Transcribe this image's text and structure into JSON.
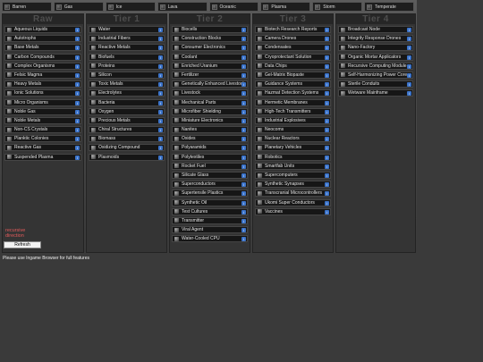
{
  "planets": [
    {
      "label": "Barren",
      "icon": "barren-planet-icon"
    },
    {
      "label": "Gas",
      "icon": "gas-planet-icon"
    },
    {
      "label": "Ice",
      "icon": "ice-planet-icon"
    },
    {
      "label": "Lava",
      "icon": "lava-planet-icon"
    },
    {
      "label": "Oceanic",
      "icon": "oceanic-planet-icon"
    },
    {
      "label": "Plasma",
      "icon": "plasma-planet-icon"
    },
    {
      "label": "Storm",
      "icon": "storm-planet-icon"
    },
    {
      "label": "Temperate",
      "icon": "temperate-planet-icon"
    }
  ],
  "info_glyph": "i",
  "tiers": [
    {
      "title": "Raw",
      "items": [
        "Aqueous Liquids",
        "Autotrophs",
        "Base Metals",
        "Carbon Compounds",
        "Complex Organisms",
        "Felsic Magma",
        "Heavy Metals",
        "Ionic Solutions",
        "Micro Organisms",
        "Noble Gas",
        "Noble Metals",
        "Non-CS Crystals",
        "Planktic Colonies",
        "Reactive Gas",
        "Suspended Plasma"
      ]
    },
    {
      "title": "Tier 1",
      "items": [
        "Water",
        "Industrial Fibers",
        "Reactive Metals",
        "Biofuels",
        "Proteins",
        "Silicon",
        "Toxic Metals",
        "Electrolytes",
        "Bacteria",
        "Oxygen",
        "Precious Metals",
        "Chiral Structures",
        "Biomass",
        "Oxidizing Compound",
        "Plasmoids"
      ]
    },
    {
      "title": "Tier 2",
      "items": [
        "Biocells",
        "Construction Blocks",
        "Consumer Electronics",
        "Coolant",
        "Enriched Uranium",
        "Fertilizer",
        "Genetically Enhanced Livestock",
        "Livestock",
        "Mechanical Parts",
        "Microfiber Shielding",
        "Miniature Electronics",
        "Nanites",
        "Oxides",
        "Polyaramids",
        "Polytextiles",
        "Rocket Fuel",
        "Silicate Glass",
        "Superconductors",
        "Supertensile Plastics",
        "Synthetic Oil",
        "Test Cultures",
        "Transmitter",
        "Viral Agent",
        "Water-Cooled CPU"
      ]
    },
    {
      "title": "Tier 3",
      "items": [
        "Biotech Research Reports",
        "Camera Drones",
        "Condensates",
        "Cryoprotectant Solution",
        "Data Chips",
        "Gel-Matrix Biopaste",
        "Guidance Systems",
        "Hazmat Detection Systems",
        "Hermetic Membranes",
        "High-Tech Transmitters",
        "Industrial Explosives",
        "Neocoms",
        "Nuclear Reactors",
        "Planetary Vehicles",
        "Robotics",
        "Smartfab Units",
        "Supercomputers",
        "Synthetic Synapses",
        "Transcranial Microcontrollers",
        "Ukomi Super Conductors",
        "Vaccines"
      ]
    },
    {
      "title": "Tier 4",
      "items": [
        "Broadcast Node",
        "Integrity Response Drones",
        "Nano-Factory",
        "Organic Mortar Applicators",
        "Recursive Computing Module",
        "Self-Harmonizing Power Core",
        "Sterile Conduits",
        "Wetware Mainframe"
      ]
    }
  ],
  "recursive_label": "recursive direction",
  "refresh_label": "Refresh",
  "footer_note": "Please use Ingame Browser for full features"
}
